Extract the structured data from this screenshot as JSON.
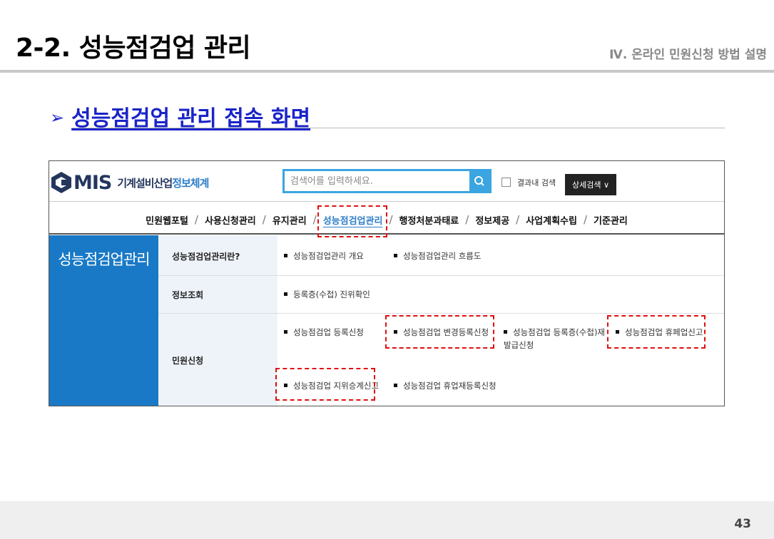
{
  "header": {
    "title": "2-2. 성능점검업 관리",
    "chapter": "Ⅳ. 온라인 민원신청 방법 설명"
  },
  "section": {
    "arrow": "➢",
    "title": "성능점검업 관리 접속 화면"
  },
  "site": {
    "logo_mark_icon": "mis-logo-icon",
    "logo_text": "MIS",
    "logo_name_main": "기계설비산업",
    "logo_name_accent": "정보체계",
    "search_placeholder": "검색어를 입력하세요.",
    "search_icon": "search-icon",
    "in_result_label": "결과내 검색",
    "detail_search_label": "상세검색 ∨",
    "nav": [
      "민원웹포털",
      "사용신청관리",
      "유지관리",
      "성능점검업관리",
      "행정처분과태료",
      "정보제공",
      "사업계획수립",
      "기준관리"
    ],
    "nav_active": "성능점검업관리",
    "nav_separator": "/",
    "side_title": "성능점검업관리",
    "rows": [
      {
        "label": "성능점검업관리란?",
        "items": [
          "성능점검업관리 개요",
          "성능점검업관리 흐름도"
        ]
      },
      {
        "label": "정보조회",
        "items": [
          "등록증(수첩) 진위확인"
        ]
      },
      {
        "label": "민원신청",
        "items": [
          "성능점검업 등록신청",
          "성능점검업 변경등록신청",
          "성능점검업 등록증(수첩)재발급신청",
          "성능점검업 휴페업신고",
          "성능점검업 지위승계신고",
          "성능점검업 휴업재등록신청"
        ]
      }
    ]
  },
  "highlight_color": "#e01010",
  "accent_color": "#1979c6",
  "page_number": "43"
}
